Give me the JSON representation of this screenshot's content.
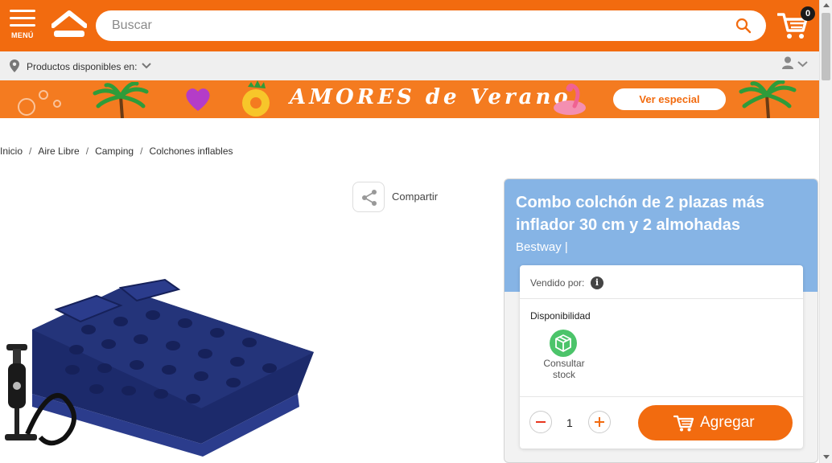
{
  "header": {
    "menu_label": "MENÚ",
    "search_placeholder": "Buscar",
    "cart_count": "0"
  },
  "location": {
    "label": "Productos disponibles en:"
  },
  "banner": {
    "title": "AMORES de Verano",
    "button_label": "Ver especial"
  },
  "breadcrumb": {
    "items": [
      "Inicio",
      "Aire Libre",
      "Camping",
      "Colchones inflables"
    ],
    "separator": "/"
  },
  "share": {
    "label": "Compartir"
  },
  "product": {
    "title": "Combo colchón de 2 plazas más inflador 30 cm y 2 almohadas",
    "brand": "Bestway  |",
    "sold_by_label": "Vendido por:",
    "availability_label": "Disponibilidad",
    "stock_label": "Consultar stock",
    "quantity": "1",
    "add_button_label": "Agregar"
  },
  "colors": {
    "brand_orange": "#f26b0f",
    "panel_blue": "#86b4e5",
    "stock_green": "#4cc46a"
  }
}
